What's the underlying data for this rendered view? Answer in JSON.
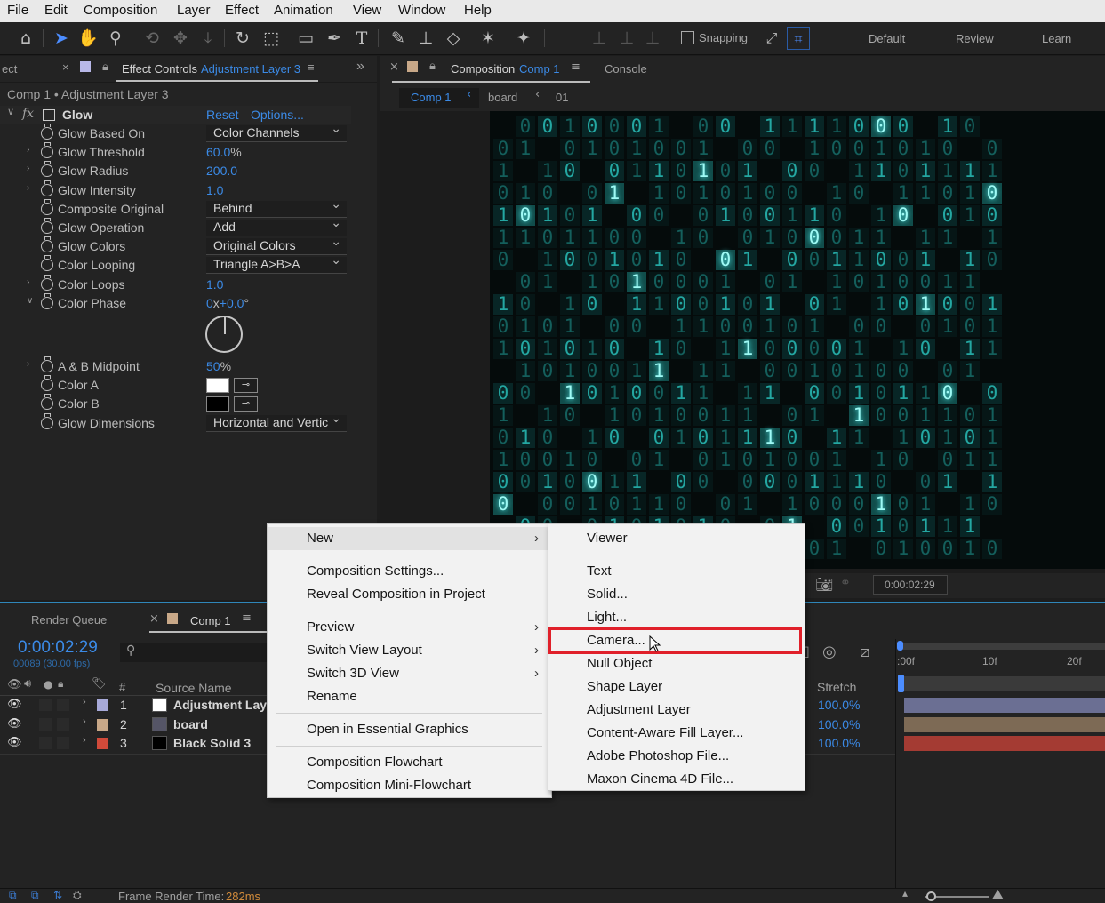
{
  "menubar": {
    "items": [
      "File",
      "Edit",
      "Composition",
      "Layer",
      "Effect",
      "Animation",
      "View",
      "Window",
      "Help"
    ]
  },
  "toolbar": {
    "snapping_label": "Snapping",
    "workspaces": [
      "Default",
      "Review",
      "Learn"
    ]
  },
  "effect_controls": {
    "left_tab_partial": "ect",
    "tab_title": "Effect Controls",
    "tab_layer": "Adjustment Layer 3",
    "breadcrumb": "Comp 1 • Adjustment Layer 3",
    "fx_label": "fx",
    "effect_name": "Glow",
    "reset": "Reset",
    "options": "Options...",
    "props": [
      {
        "name": "Glow Based On",
        "value": "Color Channels",
        "kind": "dropdown"
      },
      {
        "name": "Glow Threshold",
        "value": "60.0",
        "unit": "%",
        "kind": "value",
        "twirl": true
      },
      {
        "name": "Glow Radius",
        "value": "200.0",
        "kind": "value",
        "twirl": true
      },
      {
        "name": "Glow Intensity",
        "value": "1.0",
        "kind": "value",
        "twirl": true
      },
      {
        "name": "Composite Original",
        "value": "Behind",
        "kind": "dropdown"
      },
      {
        "name": "Glow Operation",
        "value": "Add",
        "kind": "dropdown"
      },
      {
        "name": "Glow Colors",
        "value": "Original Colors",
        "kind": "dropdown"
      },
      {
        "name": "Color Looping",
        "value": "Triangle A>B>A",
        "kind": "dropdown"
      },
      {
        "name": "Color Loops",
        "value": "1.0",
        "kind": "value",
        "twirl": true
      },
      {
        "name": "Color Phase",
        "value_a": "0",
        "value_x": "x",
        "value_b": "+0.0",
        "unit": "°",
        "kind": "angle",
        "twirl": true
      }
    ],
    "props2": [
      {
        "name": "A & B Midpoint",
        "value": "50",
        "unit": "%",
        "kind": "value",
        "twirl": true
      },
      {
        "name": "Color A",
        "kind": "swatch",
        "swatch": "#ffffff"
      },
      {
        "name": "Color B",
        "kind": "swatch",
        "swatch": "#000000"
      },
      {
        "name": "Glow Dimensions",
        "value": "Horizontal and Vertic",
        "kind": "dropdown"
      }
    ]
  },
  "composition_panel": {
    "tab_title": "Composition",
    "tab_comp": "Comp 1",
    "console": "Console",
    "flow": [
      "Comp 1",
      "board",
      "01"
    ],
    "timecode": "0:00:02:29"
  },
  "timeline": {
    "render_queue": "Render Queue",
    "comp_tab": "Comp 1",
    "timecode": "0:00:02:29",
    "frames_fps": "00089 (30.00 fps)",
    "col_hash": "#",
    "col_source": "Source Name",
    "col_stretch": "Stretch",
    "ruler": [
      ":00f",
      "10f",
      "20f"
    ],
    "layers": [
      {
        "num": "1",
        "name": "Adjustment Laye",
        "label_color": "#a7a9d8",
        "stretch": "100.0%",
        "bar_color": "#6b6f93"
      },
      {
        "num": "2",
        "name": "board",
        "label_color": "#c8a888",
        "stretch": "100.0%",
        "bar_color": "#7d6a55"
      },
      {
        "num": "3",
        "name": "Black Solid 3",
        "label_color": "#d04a3a",
        "stretch": "100.0%",
        "bar_color": "#a43b33"
      }
    ],
    "frame_render_label": "Frame Render Time:",
    "frame_render_value": "282ms"
  },
  "context_menu": {
    "items": [
      {
        "label": "New",
        "submenu": true,
        "highlight": true
      },
      {
        "sep": true
      },
      {
        "label": "Composition Settings..."
      },
      {
        "label": "Reveal Composition in Project"
      },
      {
        "sep": true
      },
      {
        "label": "Preview",
        "submenu": true
      },
      {
        "label": "Switch View Layout",
        "submenu": true
      },
      {
        "label": "Switch 3D View",
        "submenu": true
      },
      {
        "label": "Rename"
      },
      {
        "sep": true
      },
      {
        "label": "Open in Essential Graphics"
      },
      {
        "sep": true
      },
      {
        "label": "Composition Flowchart"
      },
      {
        "label": "Composition Mini-Flowchart"
      }
    ]
  },
  "new_submenu": {
    "items": [
      {
        "label": "Viewer"
      },
      {
        "sep": true
      },
      {
        "label": "Text"
      },
      {
        "label": "Solid..."
      },
      {
        "label": "Light..."
      },
      {
        "label": "Camera...",
        "selected": true
      },
      {
        "label": "Null Object"
      },
      {
        "label": "Shape Layer"
      },
      {
        "label": "Adjustment Layer"
      },
      {
        "label": "Content-Aware Fill Layer..."
      },
      {
        "label": "Adobe Photoshop File..."
      },
      {
        "label": "Maxon Cinema 4D File..."
      }
    ]
  },
  "colors": {
    "accent_blue": "#3b8ae6",
    "highlight_red": "#e0202a",
    "matrix_cyan": "#22d6d0"
  },
  "matrix_rows": [
    "10010001000111110000100",
    "01001010011000100101010",
    "11101011010100001101111",
    "01010101010100110011010",
    "10101000101001100101010",
    "11011001101010001101101",
    "01100101010110011001010",
    "00101010001001010100110",
    "10110111001010010101001",
    "01011000110010110010101",
    "10101001001100001010011",
    "01010011011000101001010",
    "00010100110110001011010",
    "10100101001100101001101",
    "01011000101110011010101",
    "10010101001010010101011",
    "00100111001000111000101",
    "01001011010101000101010",
    "10010101010101100101110",
    "01101001000101011010010"
  ]
}
